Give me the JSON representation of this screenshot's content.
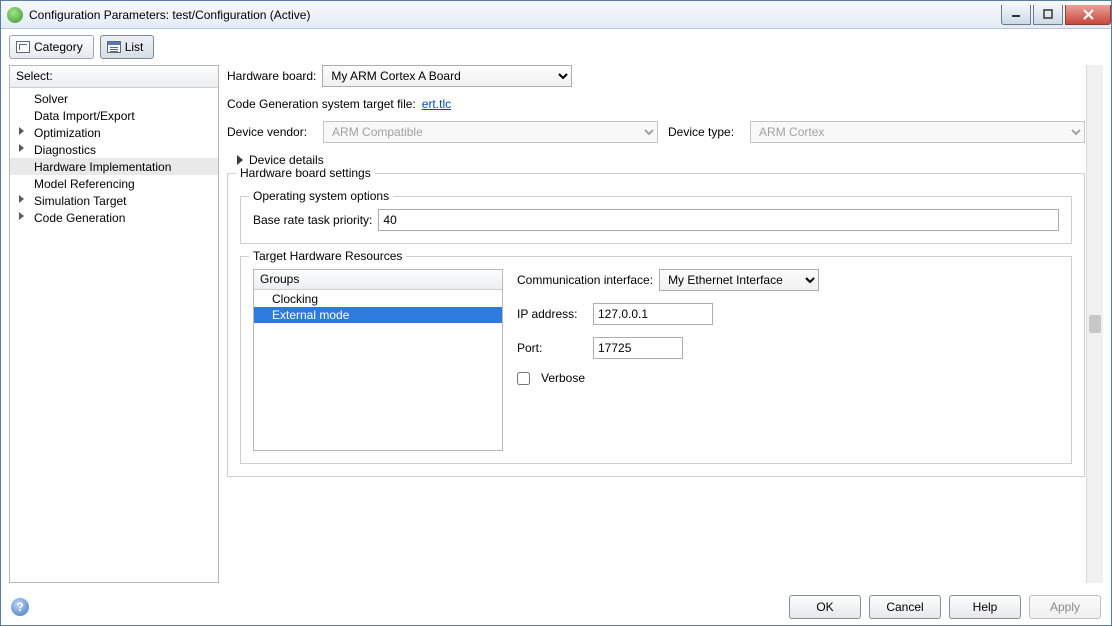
{
  "window": {
    "title": "Configuration Parameters: test/Configuration (Active)"
  },
  "toolbar": {
    "category": "Category",
    "list": "List"
  },
  "tree": {
    "header": "Select:",
    "items": [
      {
        "label": "Solver",
        "expandable": false
      },
      {
        "label": "Data Import/Export",
        "expandable": false
      },
      {
        "label": "Optimization",
        "expandable": true
      },
      {
        "label": "Diagnostics",
        "expandable": true
      },
      {
        "label": "Hardware Implementation",
        "expandable": false,
        "selected": true
      },
      {
        "label": "Model Referencing",
        "expandable": false
      },
      {
        "label": "Simulation Target",
        "expandable": true
      },
      {
        "label": "Code Generation",
        "expandable": true
      }
    ]
  },
  "main": {
    "hardware_board_label": "Hardware board:",
    "hardware_board_value": "My ARM Cortex A Board",
    "codegen_label": "Code Generation system target file:",
    "codegen_link": "ert.tlc",
    "device_vendor_label": "Device vendor:",
    "device_vendor_value": "ARM Compatible",
    "device_type_label": "Device type:",
    "device_type_value": "ARM Cortex",
    "device_details": "Device details",
    "hw_settings_legend": "Hardware board settings",
    "os_options_legend": "Operating system options",
    "base_rate_label": "Base rate task priority:",
    "base_rate_value": "40",
    "thr_legend": "Target Hardware Resources",
    "groups_header": "Groups",
    "groups": [
      {
        "label": "Clocking",
        "selected": false
      },
      {
        "label": "External mode",
        "selected": true
      }
    ],
    "comm_if_label": "Communication interface:",
    "comm_if_value": "My Ethernet Interface",
    "ip_label": "IP address:",
    "ip_value": "127.0.0.1",
    "port_label": "Port:",
    "port_value": "17725",
    "verbose_label": "Verbose"
  },
  "footer": {
    "ok": "OK",
    "cancel": "Cancel",
    "help": "Help",
    "apply": "Apply"
  }
}
